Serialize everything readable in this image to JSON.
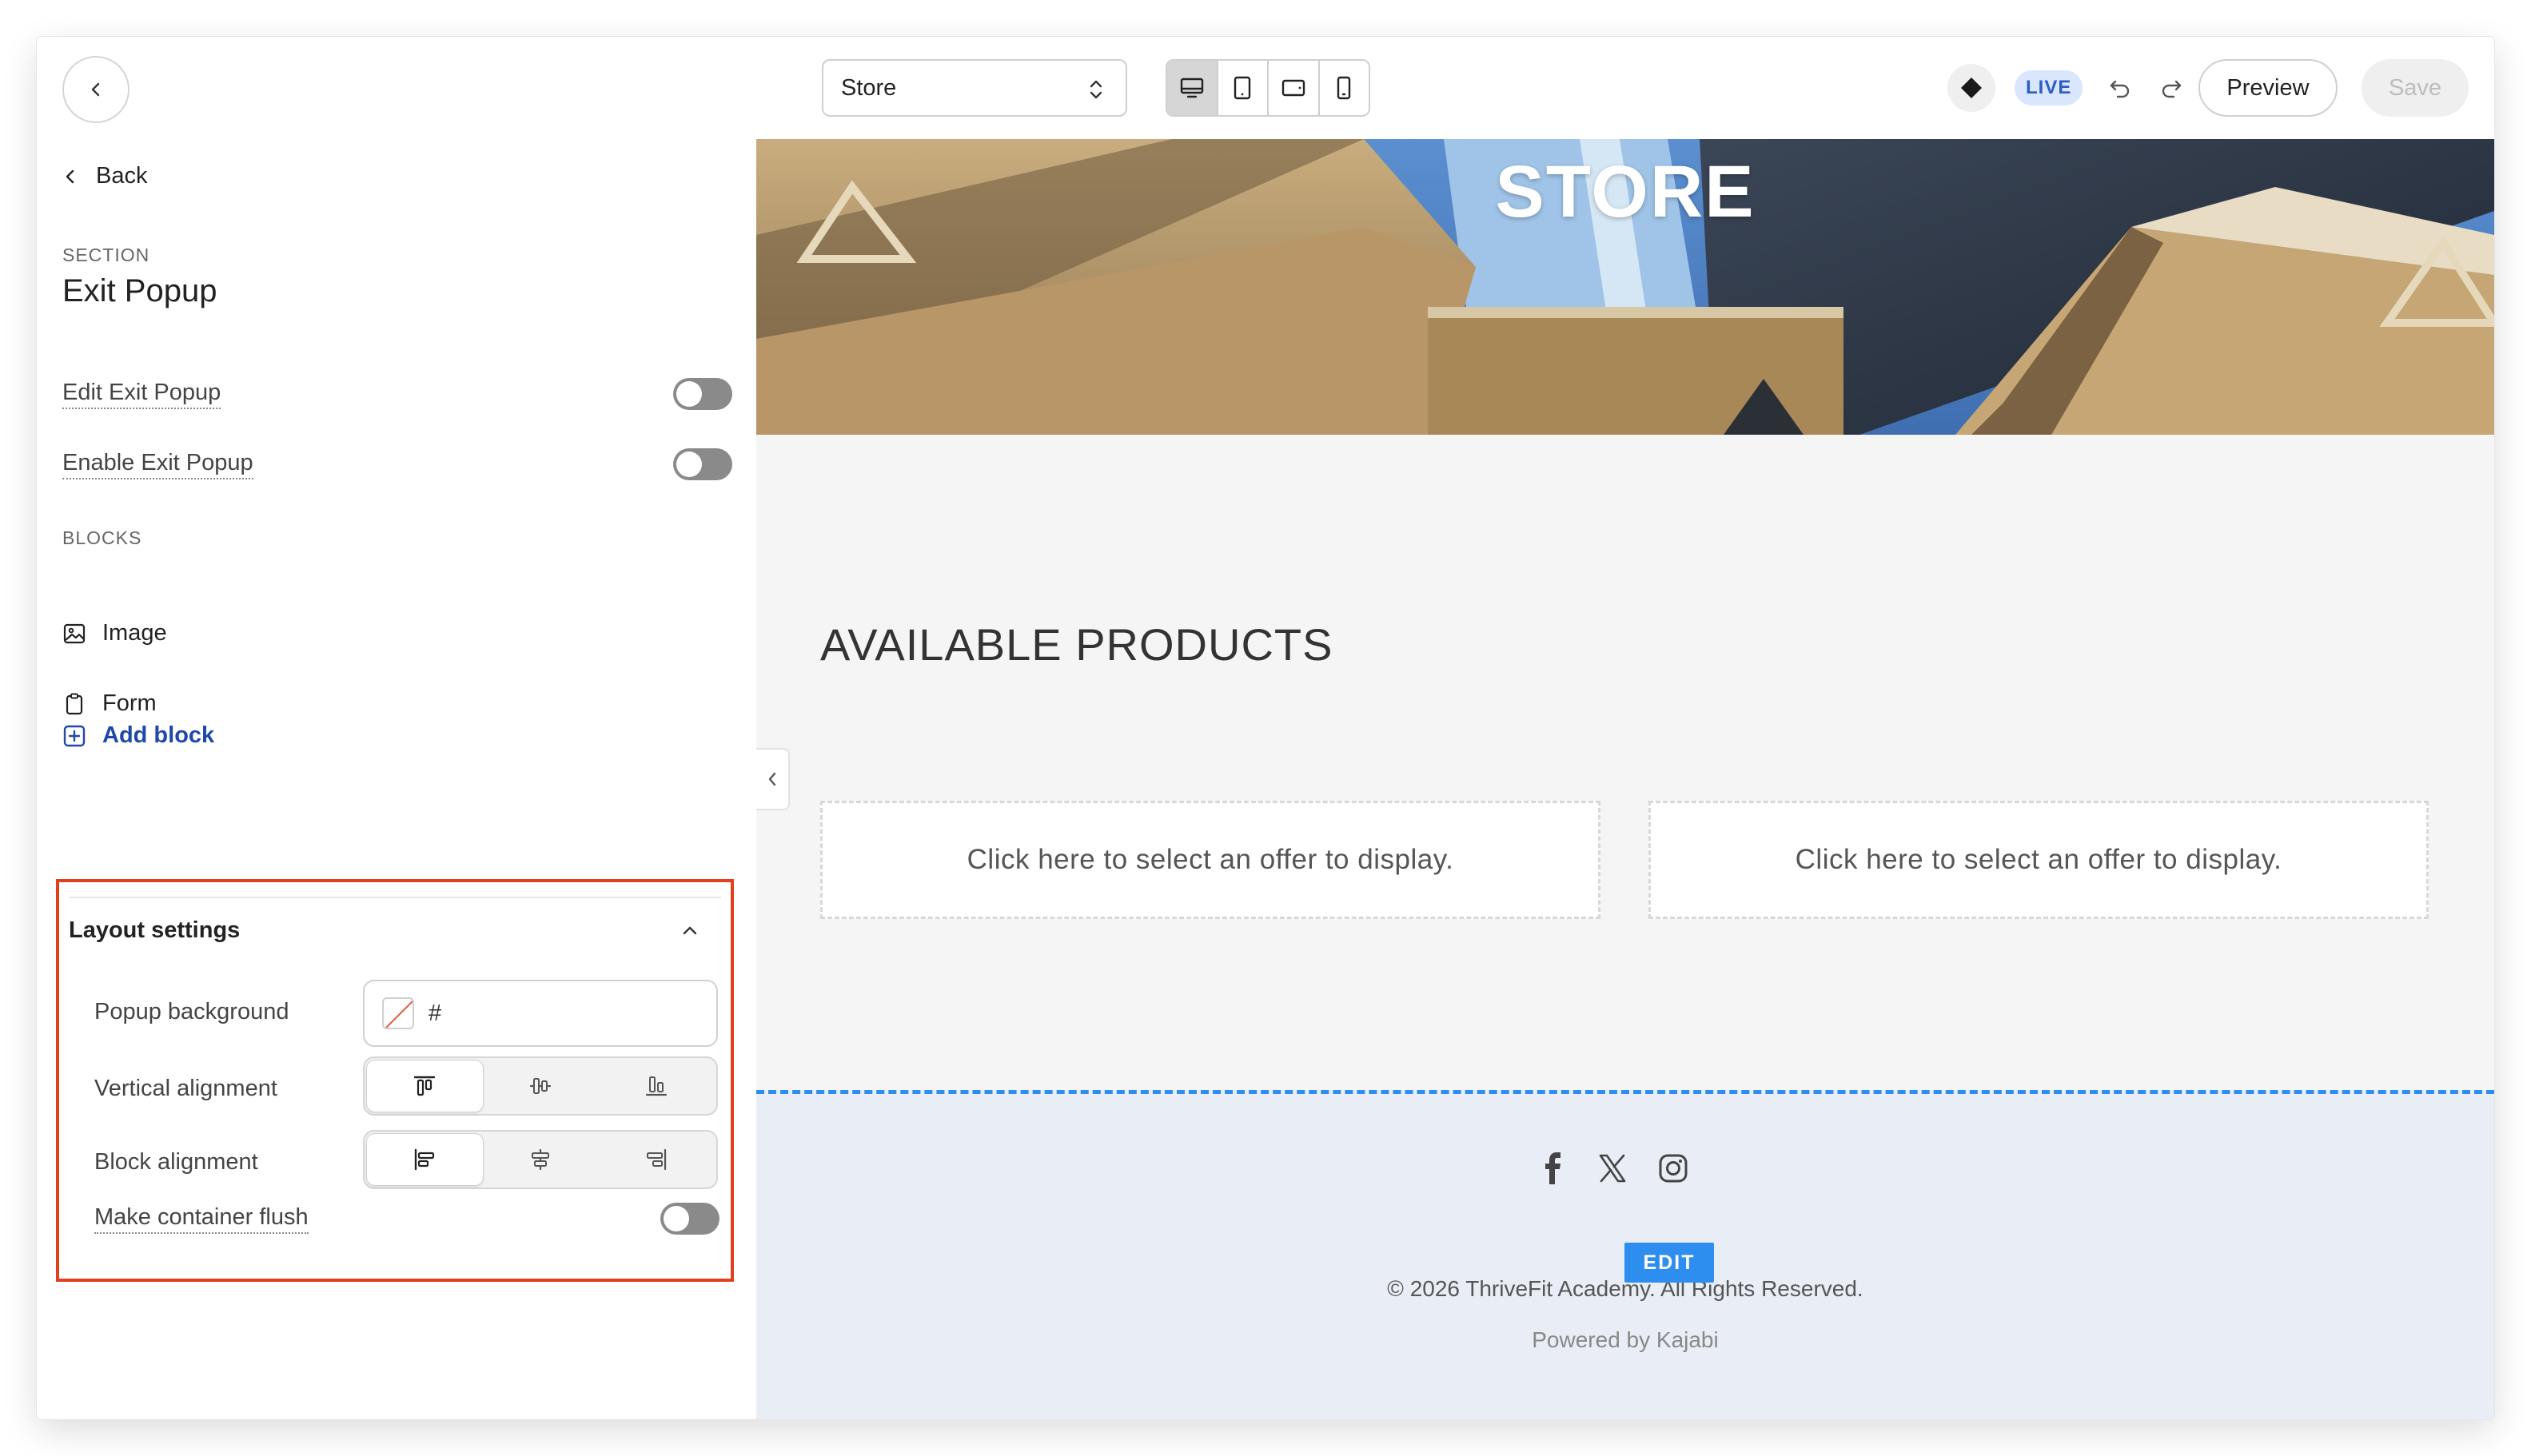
{
  "topbar": {
    "page_select": {
      "value": "Store"
    },
    "devices": [
      "desktop-icon",
      "tablet-portrait-icon",
      "tablet-landscape-icon",
      "mobile-icon"
    ],
    "active_device": "desktop",
    "live_badge": "LIVE",
    "preview_label": "Preview",
    "save_label": "Save"
  },
  "sidebar": {
    "back_label": "Back",
    "section_caption": "SECTION",
    "section_title": "Exit Popup",
    "toggles": [
      {
        "label": "Edit Exit Popup",
        "on": false
      },
      {
        "label": "Enable Exit Popup",
        "on": false
      }
    ],
    "blocks_caption": "BLOCKS",
    "blocks": [
      {
        "label": "Image",
        "icon": "image-icon"
      },
      {
        "label": "Form",
        "icon": "clipboard-icon"
      }
    ],
    "add_block_label": "Add block",
    "layout_settings": {
      "title": "Layout settings",
      "popup_background_label": "Popup background",
      "popup_background_value": "#",
      "vertical_alignment_label": "Vertical alignment",
      "vertical_alignment_selected": "top",
      "block_alignment_label": "Block alignment",
      "block_alignment_selected": "left",
      "make_flush_label": "Make container flush",
      "make_flush_on": false
    }
  },
  "preview": {
    "hero_title": "STORE",
    "products_heading": "AVAILABLE PRODUCTS",
    "offers": [
      "Click here to select an offer to display.",
      "Click here to select an offer to display."
    ],
    "footer": {
      "social_icons": [
        "facebook-icon",
        "x-icon",
        "instagram-icon"
      ],
      "edit_badge": "EDIT",
      "copyright": "© 2026 ThriveFit Academy. All Rights Reserved.",
      "powered_by": "Powered by Kajabi"
    }
  },
  "colors": {
    "highlight_border": "#e2401c",
    "live_badge_bg": "#d9e6fb",
    "live_badge_text": "#2c5dc7",
    "add_block": "#1e49a8",
    "edit_blue": "#2d8ef0",
    "footer_bg": "#e9eef6"
  }
}
